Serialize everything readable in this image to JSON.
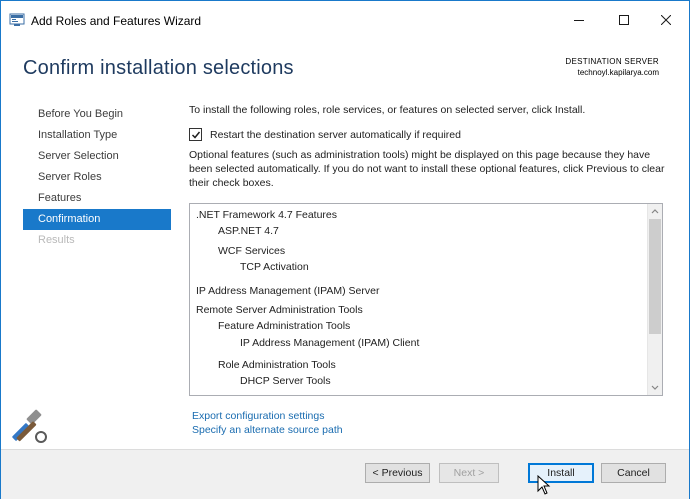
{
  "window": {
    "title": "Add Roles and Features Wizard",
    "icons": {
      "app": "server-manager-icon",
      "minimize": "minimize-icon",
      "maximize": "maximize-icon",
      "close": "close-icon"
    }
  },
  "header": {
    "title": "Confirm installation selections",
    "destination_label": "DESTINATION SERVER",
    "destination_server": "technoyl.kapilarya.com"
  },
  "nav": {
    "items": [
      {
        "label": "Before You Begin",
        "state": "normal"
      },
      {
        "label": "Installation Type",
        "state": "normal"
      },
      {
        "label": "Server Selection",
        "state": "normal"
      },
      {
        "label": "Server Roles",
        "state": "normal"
      },
      {
        "label": "Features",
        "state": "normal"
      },
      {
        "label": "Confirmation",
        "state": "active"
      },
      {
        "label": "Results",
        "state": "disabled"
      }
    ]
  },
  "content": {
    "intro": "To install the following roles, role services, or features on selected server, click Install.",
    "restart_checkbox": {
      "label": "Restart the destination server automatically if required",
      "checked": true
    },
    "optional_note": "Optional features (such as administration tools) might be displayed on this page because they have been selected automatically. If you do not want to install these optional features, click Previous to clear their check boxes.",
    "selections": [
      {
        "label": ".NET Framework 4.7 Features",
        "level": 0
      },
      {
        "label": "ASP.NET 4.7",
        "level": 1
      },
      {
        "label": "WCF Services",
        "level": 1
      },
      {
        "label": "TCP Activation",
        "level": 2
      },
      {
        "label": "IP Address Management (IPAM) Server",
        "level": 0
      },
      {
        "label": "Remote Server Administration Tools",
        "level": 0
      },
      {
        "label": "Feature Administration Tools",
        "level": 1
      },
      {
        "label": "IP Address Management (IPAM) Client",
        "level": 2
      },
      {
        "label": "Role Administration Tools",
        "level": 1
      },
      {
        "label": "DHCP Server Tools",
        "level": 2
      }
    ],
    "links": {
      "export": "Export configuration settings",
      "alternate_source": "Specify an alternate source path"
    }
  },
  "footer": {
    "previous": "< Previous",
    "next": "Next >",
    "install": "Install",
    "cancel": "Cancel"
  },
  "colors": {
    "accent": "#1979ca",
    "title": "#1e3a5f",
    "link": "#1a6cb0",
    "disabled_text": "#b9b9b9"
  }
}
